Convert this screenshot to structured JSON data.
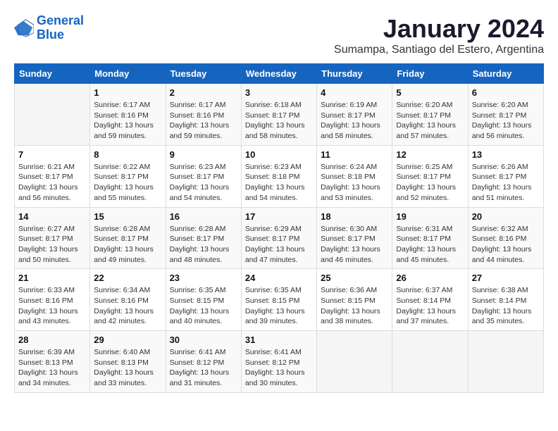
{
  "logo": {
    "line1": "General",
    "line2": "Blue"
  },
  "title": "January 2024",
  "subtitle": "Sumampa, Santiago del Estero, Argentina",
  "weekdays": [
    "Sunday",
    "Monday",
    "Tuesday",
    "Wednesday",
    "Thursday",
    "Friday",
    "Saturday"
  ],
  "weeks": [
    [
      {
        "day": null,
        "sunrise": null,
        "sunset": null,
        "daylight": null
      },
      {
        "day": "1",
        "sunrise": "Sunrise: 6:17 AM",
        "sunset": "Sunset: 8:16 PM",
        "daylight": "Daylight: 13 hours and 59 minutes."
      },
      {
        "day": "2",
        "sunrise": "Sunrise: 6:17 AM",
        "sunset": "Sunset: 8:16 PM",
        "daylight": "Daylight: 13 hours and 59 minutes."
      },
      {
        "day": "3",
        "sunrise": "Sunrise: 6:18 AM",
        "sunset": "Sunset: 8:17 PM",
        "daylight": "Daylight: 13 hours and 58 minutes."
      },
      {
        "day": "4",
        "sunrise": "Sunrise: 6:19 AM",
        "sunset": "Sunset: 8:17 PM",
        "daylight": "Daylight: 13 hours and 58 minutes."
      },
      {
        "day": "5",
        "sunrise": "Sunrise: 6:20 AM",
        "sunset": "Sunset: 8:17 PM",
        "daylight": "Daylight: 13 hours and 57 minutes."
      },
      {
        "day": "6",
        "sunrise": "Sunrise: 6:20 AM",
        "sunset": "Sunset: 8:17 PM",
        "daylight": "Daylight: 13 hours and 56 minutes."
      }
    ],
    [
      {
        "day": "7",
        "sunrise": "Sunrise: 6:21 AM",
        "sunset": "Sunset: 8:17 PM",
        "daylight": "Daylight: 13 hours and 56 minutes."
      },
      {
        "day": "8",
        "sunrise": "Sunrise: 6:22 AM",
        "sunset": "Sunset: 8:17 PM",
        "daylight": "Daylight: 13 hours and 55 minutes."
      },
      {
        "day": "9",
        "sunrise": "Sunrise: 6:23 AM",
        "sunset": "Sunset: 8:17 PM",
        "daylight": "Daylight: 13 hours and 54 minutes."
      },
      {
        "day": "10",
        "sunrise": "Sunrise: 6:23 AM",
        "sunset": "Sunset: 8:18 PM",
        "daylight": "Daylight: 13 hours and 54 minutes."
      },
      {
        "day": "11",
        "sunrise": "Sunrise: 6:24 AM",
        "sunset": "Sunset: 8:18 PM",
        "daylight": "Daylight: 13 hours and 53 minutes."
      },
      {
        "day": "12",
        "sunrise": "Sunrise: 6:25 AM",
        "sunset": "Sunset: 8:17 PM",
        "daylight": "Daylight: 13 hours and 52 minutes."
      },
      {
        "day": "13",
        "sunrise": "Sunrise: 6:26 AM",
        "sunset": "Sunset: 8:17 PM",
        "daylight": "Daylight: 13 hours and 51 minutes."
      }
    ],
    [
      {
        "day": "14",
        "sunrise": "Sunrise: 6:27 AM",
        "sunset": "Sunset: 8:17 PM",
        "daylight": "Daylight: 13 hours and 50 minutes."
      },
      {
        "day": "15",
        "sunrise": "Sunrise: 6:28 AM",
        "sunset": "Sunset: 8:17 PM",
        "daylight": "Daylight: 13 hours and 49 minutes."
      },
      {
        "day": "16",
        "sunrise": "Sunrise: 6:28 AM",
        "sunset": "Sunset: 8:17 PM",
        "daylight": "Daylight: 13 hours and 48 minutes."
      },
      {
        "day": "17",
        "sunrise": "Sunrise: 6:29 AM",
        "sunset": "Sunset: 8:17 PM",
        "daylight": "Daylight: 13 hours and 47 minutes."
      },
      {
        "day": "18",
        "sunrise": "Sunrise: 6:30 AM",
        "sunset": "Sunset: 8:17 PM",
        "daylight": "Daylight: 13 hours and 46 minutes."
      },
      {
        "day": "19",
        "sunrise": "Sunrise: 6:31 AM",
        "sunset": "Sunset: 8:17 PM",
        "daylight": "Daylight: 13 hours and 45 minutes."
      },
      {
        "day": "20",
        "sunrise": "Sunrise: 6:32 AM",
        "sunset": "Sunset: 8:16 PM",
        "daylight": "Daylight: 13 hours and 44 minutes."
      }
    ],
    [
      {
        "day": "21",
        "sunrise": "Sunrise: 6:33 AM",
        "sunset": "Sunset: 8:16 PM",
        "daylight": "Daylight: 13 hours and 43 minutes."
      },
      {
        "day": "22",
        "sunrise": "Sunrise: 6:34 AM",
        "sunset": "Sunset: 8:16 PM",
        "daylight": "Daylight: 13 hours and 42 minutes."
      },
      {
        "day": "23",
        "sunrise": "Sunrise: 6:35 AM",
        "sunset": "Sunset: 8:15 PM",
        "daylight": "Daylight: 13 hours and 40 minutes."
      },
      {
        "day": "24",
        "sunrise": "Sunrise: 6:35 AM",
        "sunset": "Sunset: 8:15 PM",
        "daylight": "Daylight: 13 hours and 39 minutes."
      },
      {
        "day": "25",
        "sunrise": "Sunrise: 6:36 AM",
        "sunset": "Sunset: 8:15 PM",
        "daylight": "Daylight: 13 hours and 38 minutes."
      },
      {
        "day": "26",
        "sunrise": "Sunrise: 6:37 AM",
        "sunset": "Sunset: 8:14 PM",
        "daylight": "Daylight: 13 hours and 37 minutes."
      },
      {
        "day": "27",
        "sunrise": "Sunrise: 6:38 AM",
        "sunset": "Sunset: 8:14 PM",
        "daylight": "Daylight: 13 hours and 35 minutes."
      }
    ],
    [
      {
        "day": "28",
        "sunrise": "Sunrise: 6:39 AM",
        "sunset": "Sunset: 8:13 PM",
        "daylight": "Daylight: 13 hours and 34 minutes."
      },
      {
        "day": "29",
        "sunrise": "Sunrise: 6:40 AM",
        "sunset": "Sunset: 8:13 PM",
        "daylight": "Daylight: 13 hours and 33 minutes."
      },
      {
        "day": "30",
        "sunrise": "Sunrise: 6:41 AM",
        "sunset": "Sunset: 8:12 PM",
        "daylight": "Daylight: 13 hours and 31 minutes."
      },
      {
        "day": "31",
        "sunrise": "Sunrise: 6:41 AM",
        "sunset": "Sunset: 8:12 PM",
        "daylight": "Daylight: 13 hours and 30 minutes."
      },
      {
        "day": null,
        "sunrise": null,
        "sunset": null,
        "daylight": null
      },
      {
        "day": null,
        "sunrise": null,
        "sunset": null,
        "daylight": null
      },
      {
        "day": null,
        "sunrise": null,
        "sunset": null,
        "daylight": null
      }
    ]
  ]
}
